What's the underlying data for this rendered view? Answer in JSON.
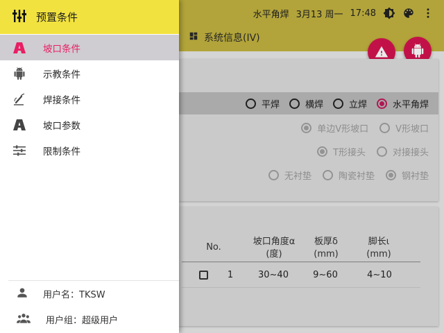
{
  "statusbar": {
    "mode": "水平角焊",
    "date": "3月13 周一",
    "time": "17:48"
  },
  "tabs": {
    "system_info": "系统信息(IV)"
  },
  "weld_positions": {
    "options": [
      "平焊",
      "横焊",
      "立焊",
      "水平角焊"
    ],
    "selected": "水平角焊"
  },
  "groove_options": {
    "row1": [
      "单边V形坡口",
      "V形坡口"
    ],
    "row1_selected": "单边V形坡口",
    "row2": [
      "T形接头",
      "对接接头"
    ],
    "row2_selected": "T形接头",
    "row3": [
      "无衬垫",
      "陶瓷衬垫",
      "钢衬垫"
    ],
    "row3_selected": "钢衬垫"
  },
  "table": {
    "headers": {
      "no": "No.",
      "angle_line1": "坡口角度α",
      "angle_line2": "(度)",
      "thickness_line1": "板厚δ",
      "thickness_line2": "(mm)",
      "leg_line1": "脚长ι",
      "leg_line2": "(mm)"
    },
    "rows": [
      {
        "no": "1",
        "angle": "30~40",
        "thickness": "9~60",
        "leg": "4~10"
      }
    ]
  },
  "drawer": {
    "title": "预置条件",
    "items": [
      {
        "label": "坡口条件",
        "icon": "groove-icon",
        "active": true
      },
      {
        "label": "示教条件",
        "icon": "android-icon",
        "active": false
      },
      {
        "label": "焊接条件",
        "icon": "welding-torch-icon",
        "active": false
      },
      {
        "label": "坡口参数",
        "icon": "groove-icon",
        "active": false
      },
      {
        "label": "限制条件",
        "icon": "sliders-icon",
        "active": false
      }
    ],
    "footer": {
      "username": "用户名：TKSW",
      "usergroup": "用户组：超级用户"
    }
  },
  "colors": {
    "header_yellow": "#f2e23f",
    "appbar_dim": "#c2b23f",
    "accent_pink": "#e91e63",
    "fab_red": "#d3134f"
  }
}
